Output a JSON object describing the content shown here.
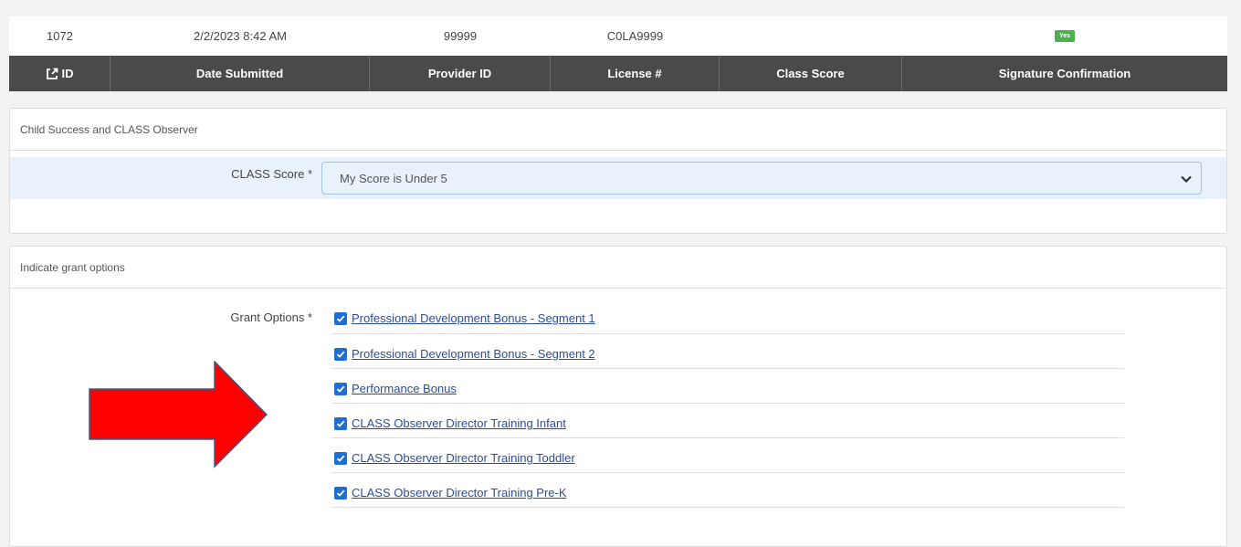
{
  "summary": {
    "values": {
      "id": "1072",
      "date_submitted": "2/2/2023 8:42 AM",
      "provider_id": "99999",
      "license": "C0LA9999",
      "class_score": "",
      "signature_confirmation": "Yes"
    },
    "headers": {
      "id": "ID",
      "date_submitted": "Date Submitted",
      "provider_id": "Provider ID",
      "license": "License #",
      "class_score": "Class Score",
      "signature_confirmation": "Signature Confirmation"
    }
  },
  "panel_observer": {
    "heading": "Child Success and CLASS Observer",
    "class_score_label": "CLASS Score *",
    "class_score_value": "My Score is Under 5"
  },
  "panel_grant": {
    "heading": "Indicate grant options",
    "grant_options_label": "Grant Options *",
    "options": [
      {
        "label": "Professional Development Bonus - Segment 1",
        "checked": true
      },
      {
        "label": "Professional Development Bonus - Segment 2",
        "checked": true
      },
      {
        "label": "Performance Bonus",
        "checked": true
      },
      {
        "label": "CLASS Observer Director Training Infant",
        "checked": true
      },
      {
        "label": "CLASS Observer Director Training Toddler",
        "checked": true
      },
      {
        "label": "CLASS Observer Director Training Pre-K",
        "checked": true
      }
    ]
  },
  "colors": {
    "header_bg": "#4a4a4a",
    "badge_green": "#4caf50",
    "checkbox_blue": "#1f6ed4",
    "link_blue": "#2a4d9b",
    "arrow_red": "#ff0000",
    "select_bg": "#e9f2fb"
  },
  "icons": {
    "id_header_icon": "external-link-icon",
    "select_icon": "chevron-down-icon",
    "checkbox_icon": "checkmark-icon",
    "annotation": "red-arrow"
  }
}
